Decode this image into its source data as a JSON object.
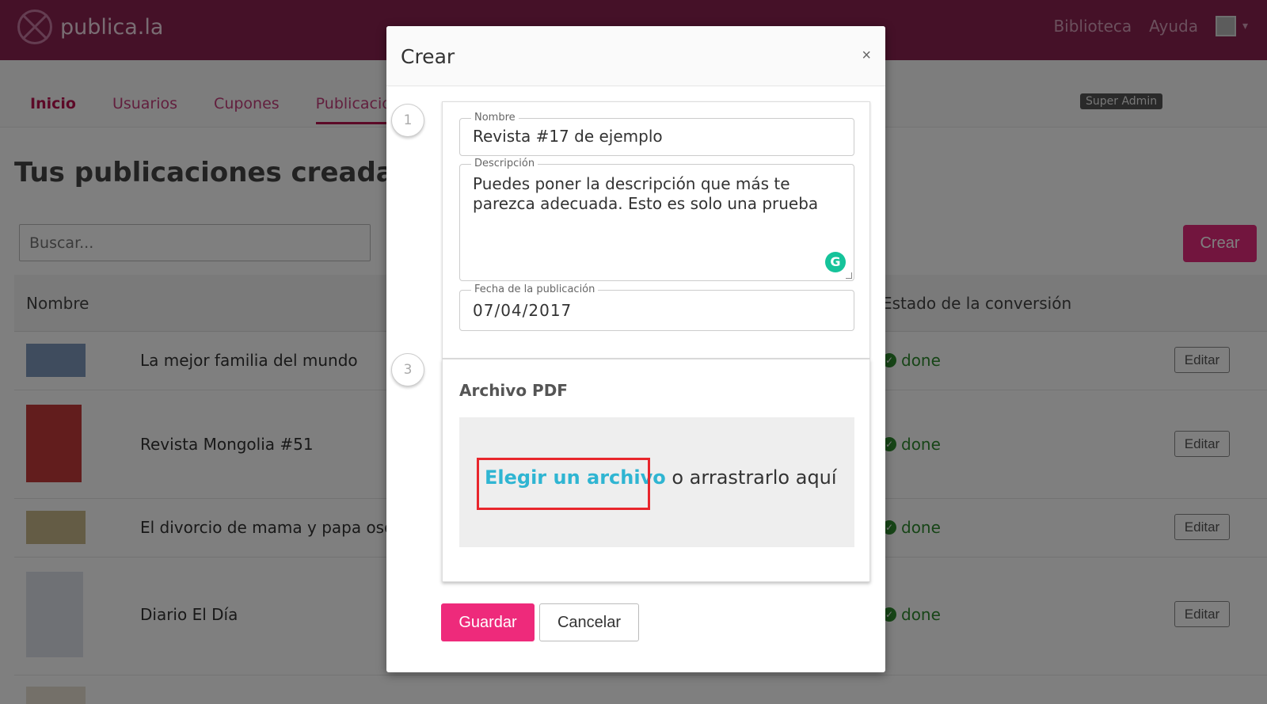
{
  "app": {
    "logo_text": "publica.la",
    "nav": [
      "Biblioteca",
      "Ayuda"
    ]
  },
  "subnav": {
    "tabs": [
      "Inicio",
      "Usuarios",
      "Cupones",
      "Publicacio"
    ],
    "badge": "Super Admin"
  },
  "main": {
    "title": "Tus publicaciones creadas",
    "search_placeholder": "Buscar...",
    "create_button": "Crear",
    "columns": [
      "Nombre",
      "Estado de la conversión"
    ],
    "rows": [
      {
        "name": "La mejor familia del mundo",
        "status": "done",
        "action": "Editar"
      },
      {
        "name": "Revista Mongolia #51",
        "status": "done",
        "action": "Editar"
      },
      {
        "name": "El divorcio de mama y papa oso",
        "status": "done",
        "action": "Editar"
      },
      {
        "name": "Diario El Día",
        "status": "done",
        "action": "Editar"
      }
    ]
  },
  "modal": {
    "title": "Crear",
    "close": "×",
    "steps": [
      "1",
      "3"
    ],
    "nombre_label": "Nombre",
    "nombre_value": "Revista #17 de ejemplo",
    "descripcion_label": "Descripción",
    "descripcion_value": "Puedes poner la descripción que más te parezca adecuada. Esto es solo una prueba",
    "fecha_label": "Fecha de la publicación",
    "fecha_value": "07/04/2017",
    "pdf_title": "Archivo PDF",
    "dropzone_link": "Elegir un archivo",
    "dropzone_text": " o arrastrarlo aquí",
    "save_button": "Guardar",
    "cancel_button": "Cancelar"
  },
  "colors": {
    "topbar": "#8b2350",
    "accent": "#ee2a7b",
    "link": "#2fb5d2",
    "highlight": "#e8262c",
    "done": "#2e8a2e"
  }
}
